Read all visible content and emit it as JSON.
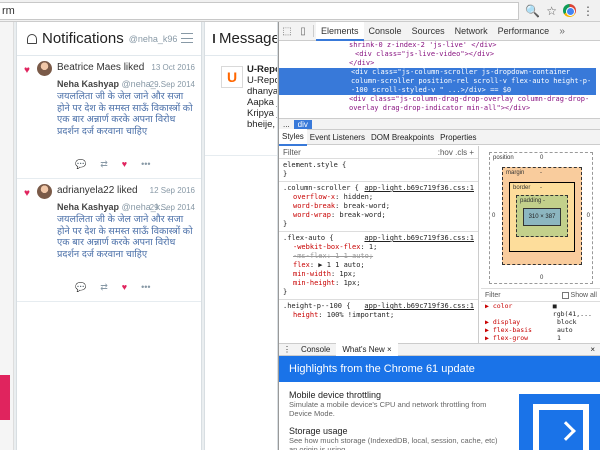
{
  "browser": {
    "address_text": "rm"
  },
  "notifications": {
    "title": "Notifications",
    "user": "@neha_k96",
    "items": [
      {
        "liker": "Beatrice Maes",
        "action": "liked",
        "date": "13 Oct 2016",
        "author_name": "Neha Kashyap",
        "author_handle": "@neha_...",
        "inner_date": "29 Sep 2014",
        "body": "जयललिता जी के जेल जाने और सजा होने पर देश के समस्त साऊँ विकास्त्रों को एक बार अन्नार्ण करके अपना विरोध प्रदर्शन दर्ज करवाना चाहिए"
      },
      {
        "liker": "adrianyela22",
        "action": "liked",
        "date": "12 Sep 2016",
        "author_name": "Neha Kashyap",
        "author_handle": "@neha_k...",
        "inner_date": "29 Sep 2014",
        "body": "जयललिता जी के जेल जाने और सजा होने पर देश के समस्त साऊँ विकास्त्रों को एक बार अन्नार्ण करके अपना विरोध प्रदर्शन दर्ज करवाना चाहिए"
      }
    ]
  },
  "messages": {
    "title": "Message",
    "item_lines": [
      "U-Report",
      "U-Repor",
      "dhanyaw",
      "Aapka ja",
      "Kripya ja",
      "bheije, j"
    ]
  },
  "devtools": {
    "tabs": [
      "Elements",
      "Console",
      "Sources",
      "Network",
      "Performance"
    ],
    "active_tab": "Elements",
    "dom_lines": [
      "shrink-0 z-index-2 'js-live' </div>",
      "<div class=\"js-live-video\"></div>",
      "</div>",
      "<div class=\"js-column-scroller js-dropdown-container column-scroller position-rel scroll-v flex-auto height-p--100 scroll-styled-v \" ...>/div>  == $0",
      "<div class=\"js-column-drag-drop-overlay column-drag-drop-overlay drag-drop-indicator min-all\"></div>"
    ],
    "crumb_dots": "...",
    "crumb_current": "div",
    "sub_tabs": [
      "Styles",
      "Event Listeners",
      "DOM Breakpoints",
      "Properties"
    ],
    "filter_placeholder": "Filter",
    "filter_right": ":hov  .cls  +",
    "rules": [
      {
        "selector": "element.style {",
        "src": "",
        "props": [],
        "close": "}"
      },
      {
        "selector": ".column-scroller {",
        "src": "app-light.b69c719f36.css:1",
        "props": [
          {
            "k": "overflow-x",
            "v": ": hidden;",
            "struck": false
          },
          {
            "k": "word-break",
            "v": ": break-word;",
            "struck": false
          },
          {
            "k": "word-wrap",
            "v": ": break-word;",
            "struck": false
          }
        ],
        "close": "}"
      },
      {
        "selector": ".flex-auto {",
        "src": "app-light.b69c719f36.css:1",
        "props": [
          {
            "k": "-webkit-box-flex",
            "v": ": 1;",
            "struck": false
          },
          {
            "k": "-ms-flex",
            "v": ": 1 1 auto;",
            "struck": true
          },
          {
            "k": "flex",
            "v": ": ▶ 1 1 auto;",
            "struck": false
          },
          {
            "k": "min-width",
            "v": ": 1px;",
            "struck": false
          },
          {
            "k": "min-height",
            "v": ": 1px;",
            "struck": false
          }
        ],
        "close": "}"
      },
      {
        "selector": ".height-p--100 {",
        "src": "app-light.b69c719f36.css:1",
        "props": [
          {
            "k": "height",
            "v": ": 100% !important;",
            "struck": false
          }
        ],
        "close": ""
      }
    ],
    "boxmodel": {
      "position_label": "position",
      "position_value": "0",
      "margin_label": "margin",
      "margin_value": "-",
      "border_label": "border",
      "border_value": "-",
      "padding_label": "padding -",
      "content": "310 × 387",
      "side_value": "0"
    },
    "computed": {
      "filter": "Filter",
      "show_all": "Show all",
      "rows": [
        {
          "k": "▶ color",
          "v": "■ rgb(41,..."
        },
        {
          "k": "▶ display",
          "v": "block"
        },
        {
          "k": "▶ flex-basis",
          "v": "auto"
        },
        {
          "k": "▶ flex-grow",
          "v": "1"
        }
      ]
    },
    "drawer_tabs": [
      "Console",
      "What's New ×"
    ],
    "drawer_close": "×",
    "whats_new_title": "Highlights from the Chrome 61 update",
    "whats_new_items": [
      {
        "heading": "Mobile device throttling",
        "desc": "Simulate a mobile device's CPU and network throttling from Device Mode."
      },
      {
        "heading": "Storage usage",
        "desc": "See how much storage (IndexedDB, local, session, cache, etc) an origin is using."
      }
    ]
  }
}
